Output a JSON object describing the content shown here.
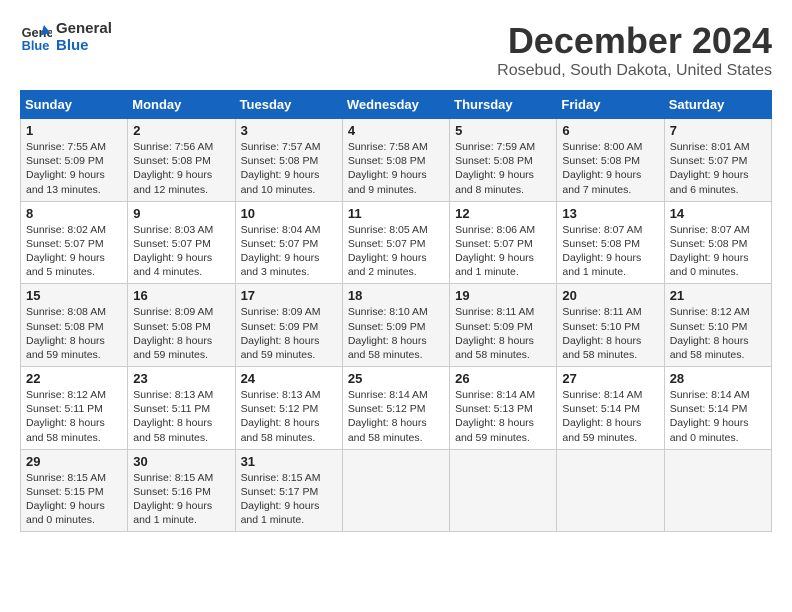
{
  "header": {
    "logo_line1": "General",
    "logo_line2": "Blue",
    "main_title": "December 2024",
    "subtitle": "Rosebud, South Dakota, United States"
  },
  "days_of_week": [
    "Sunday",
    "Monday",
    "Tuesday",
    "Wednesday",
    "Thursday",
    "Friday",
    "Saturday"
  ],
  "weeks": [
    [
      {
        "day": "1",
        "sunrise": "7:55 AM",
        "sunset": "5:09 PM",
        "daylight": "9 hours and 13 minutes."
      },
      {
        "day": "2",
        "sunrise": "7:56 AM",
        "sunset": "5:08 PM",
        "daylight": "9 hours and 12 minutes."
      },
      {
        "day": "3",
        "sunrise": "7:57 AM",
        "sunset": "5:08 PM",
        "daylight": "9 hours and 10 minutes."
      },
      {
        "day": "4",
        "sunrise": "7:58 AM",
        "sunset": "5:08 PM",
        "daylight": "9 hours and 9 minutes."
      },
      {
        "day": "5",
        "sunrise": "7:59 AM",
        "sunset": "5:08 PM",
        "daylight": "9 hours and 8 minutes."
      },
      {
        "day": "6",
        "sunrise": "8:00 AM",
        "sunset": "5:08 PM",
        "daylight": "9 hours and 7 minutes."
      },
      {
        "day": "7",
        "sunrise": "8:01 AM",
        "sunset": "5:07 PM",
        "daylight": "9 hours and 6 minutes."
      }
    ],
    [
      {
        "day": "8",
        "sunrise": "8:02 AM",
        "sunset": "5:07 PM",
        "daylight": "9 hours and 5 minutes."
      },
      {
        "day": "9",
        "sunrise": "8:03 AM",
        "sunset": "5:07 PM",
        "daylight": "9 hours and 4 minutes."
      },
      {
        "day": "10",
        "sunrise": "8:04 AM",
        "sunset": "5:07 PM",
        "daylight": "9 hours and 3 minutes."
      },
      {
        "day": "11",
        "sunrise": "8:05 AM",
        "sunset": "5:07 PM",
        "daylight": "9 hours and 2 minutes."
      },
      {
        "day": "12",
        "sunrise": "8:06 AM",
        "sunset": "5:07 PM",
        "daylight": "9 hours and 1 minute."
      },
      {
        "day": "13",
        "sunrise": "8:07 AM",
        "sunset": "5:08 PM",
        "daylight": "9 hours and 1 minute."
      },
      {
        "day": "14",
        "sunrise": "8:07 AM",
        "sunset": "5:08 PM",
        "daylight": "9 hours and 0 minutes."
      }
    ],
    [
      {
        "day": "15",
        "sunrise": "8:08 AM",
        "sunset": "5:08 PM",
        "daylight": "8 hours and 59 minutes."
      },
      {
        "day": "16",
        "sunrise": "8:09 AM",
        "sunset": "5:08 PM",
        "daylight": "8 hours and 59 minutes."
      },
      {
        "day": "17",
        "sunrise": "8:09 AM",
        "sunset": "5:09 PM",
        "daylight": "8 hours and 59 minutes."
      },
      {
        "day": "18",
        "sunrise": "8:10 AM",
        "sunset": "5:09 PM",
        "daylight": "8 hours and 58 minutes."
      },
      {
        "day": "19",
        "sunrise": "8:11 AM",
        "sunset": "5:09 PM",
        "daylight": "8 hours and 58 minutes."
      },
      {
        "day": "20",
        "sunrise": "8:11 AM",
        "sunset": "5:10 PM",
        "daylight": "8 hours and 58 minutes."
      },
      {
        "day": "21",
        "sunrise": "8:12 AM",
        "sunset": "5:10 PM",
        "daylight": "8 hours and 58 minutes."
      }
    ],
    [
      {
        "day": "22",
        "sunrise": "8:12 AM",
        "sunset": "5:11 PM",
        "daylight": "8 hours and 58 minutes."
      },
      {
        "day": "23",
        "sunrise": "8:13 AM",
        "sunset": "5:11 PM",
        "daylight": "8 hours and 58 minutes."
      },
      {
        "day": "24",
        "sunrise": "8:13 AM",
        "sunset": "5:12 PM",
        "daylight": "8 hours and 58 minutes."
      },
      {
        "day": "25",
        "sunrise": "8:14 AM",
        "sunset": "5:12 PM",
        "daylight": "8 hours and 58 minutes."
      },
      {
        "day": "26",
        "sunrise": "8:14 AM",
        "sunset": "5:13 PM",
        "daylight": "8 hours and 59 minutes."
      },
      {
        "day": "27",
        "sunrise": "8:14 AM",
        "sunset": "5:14 PM",
        "daylight": "8 hours and 59 minutes."
      },
      {
        "day": "28",
        "sunrise": "8:14 AM",
        "sunset": "5:14 PM",
        "daylight": "9 hours and 0 minutes."
      }
    ],
    [
      {
        "day": "29",
        "sunrise": "8:15 AM",
        "sunset": "5:15 PM",
        "daylight": "9 hours and 0 minutes."
      },
      {
        "day": "30",
        "sunrise": "8:15 AM",
        "sunset": "5:16 PM",
        "daylight": "9 hours and 1 minute."
      },
      {
        "day": "31",
        "sunrise": "8:15 AM",
        "sunset": "5:17 PM",
        "daylight": "9 hours and 1 minute."
      },
      null,
      null,
      null,
      null
    ]
  ]
}
